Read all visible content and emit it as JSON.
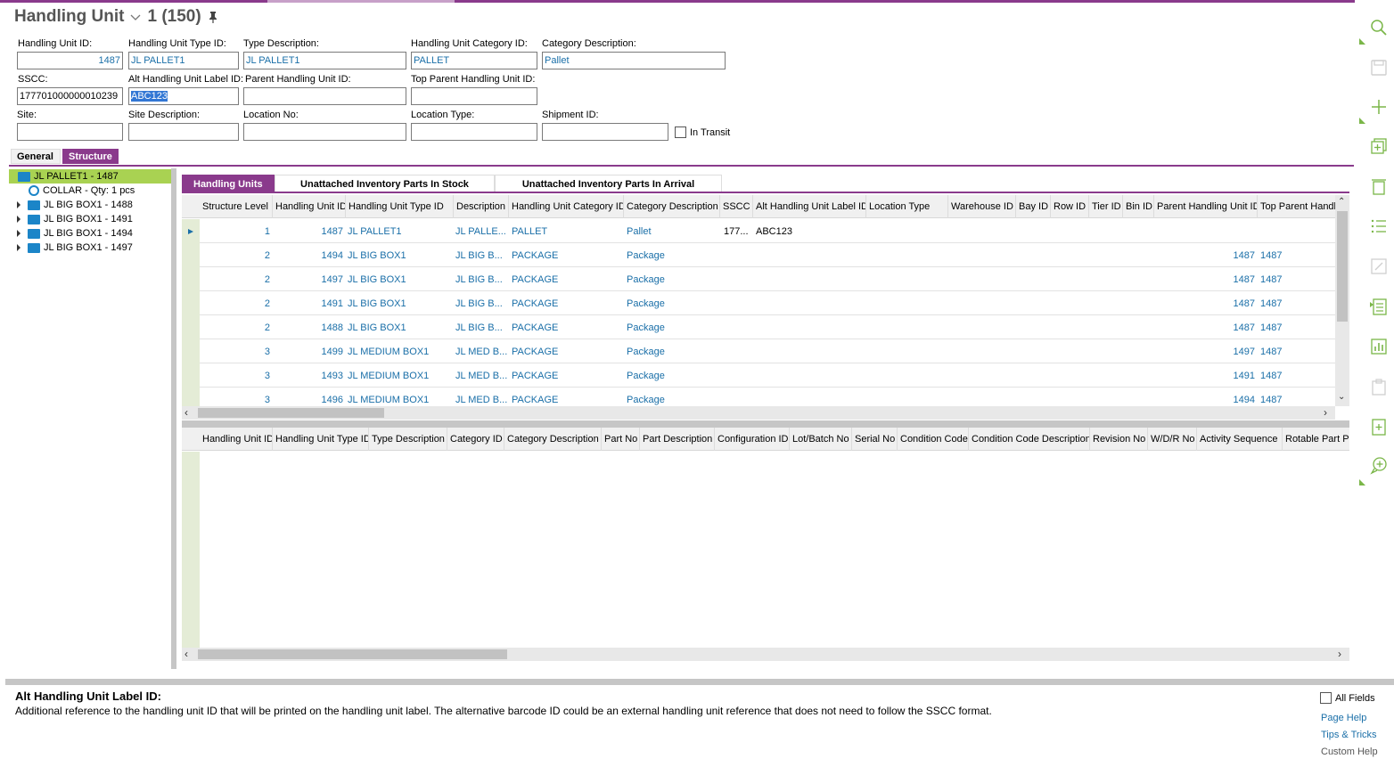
{
  "header": {
    "title": "Handling Unit",
    "record_count": "1 (150)"
  },
  "form": {
    "handling_unit_id": {
      "label": "Handling Unit ID:",
      "value": "1487"
    },
    "handling_unit_type_id": {
      "label": "Handling Unit Type ID:",
      "value": "JL PALLET1"
    },
    "type_description": {
      "label": "Type Description:",
      "value": "JL PALLET1"
    },
    "handling_unit_category_id": {
      "label": "Handling Unit Category ID:",
      "value": "PALLET"
    },
    "category_description": {
      "label": "Category Description:",
      "value": "Pallet"
    },
    "sscc": {
      "label": "SSCC:",
      "value": "177701000000010239"
    },
    "alt_handling_unit_label_id": {
      "label": "Alt Handling Unit Label ID:",
      "value": "ABC123"
    },
    "parent_handling_unit_id": {
      "label": "Parent Handling Unit ID:",
      "value": ""
    },
    "top_parent_handling_unit_id": {
      "label": "Top Parent Handling Unit ID:",
      "value": ""
    },
    "site": {
      "label": "Site:",
      "value": ""
    },
    "site_description": {
      "label": "Site Description:",
      "value": ""
    },
    "location_no": {
      "label": "Location No:",
      "value": ""
    },
    "location_type": {
      "label": "Location Type:",
      "value": ""
    },
    "shipment_id": {
      "label": "Shipment ID:",
      "value": ""
    },
    "in_transit": {
      "label": "In Transit",
      "checked": false
    }
  },
  "main_tabs": [
    "General",
    "Structure"
  ],
  "tree": [
    {
      "label": "JL PALLET1 - 1487",
      "type": "folder",
      "selected": true
    },
    {
      "label": "COLLAR - Qty: 1 pcs",
      "type": "part"
    },
    {
      "label": "JL BIG BOX1 - 1488",
      "type": "folder"
    },
    {
      "label": "JL BIG BOX1 - 1491",
      "type": "folder"
    },
    {
      "label": "JL BIG BOX1 - 1494",
      "type": "folder"
    },
    {
      "label": "JL BIG BOX1 - 1497",
      "type": "folder"
    }
  ],
  "sub_tabs": [
    "Handling Units",
    "Unattached Inventory Parts In Stock",
    "Unattached Inventory Parts In Arrival"
  ],
  "upper_grid": {
    "columns": [
      "Structure Level",
      "Handling Unit ID",
      "Handling Unit Type ID",
      "Description",
      "Handling Unit Category ID",
      "Category Description",
      "SSCC",
      "Alt Handling Unit Label ID",
      "Location Type",
      "Warehouse ID",
      "Bay ID",
      "Row ID",
      "Tier ID",
      "Bin ID",
      "Parent Handling Unit ID",
      "Top Parent Handli"
    ],
    "rows": [
      {
        "level": "1",
        "hu_id": "1487",
        "type_id": "JL PALLET1",
        "desc": "JL PALLE...",
        "cat_id": "PALLET",
        "cat_desc": "Pallet",
        "sscc": "177...",
        "alt": "ABC123",
        "parent": "",
        "top_parent": ""
      },
      {
        "level": "2",
        "hu_id": "1494",
        "type_id": "JL BIG BOX1",
        "desc": "JL BIG B...",
        "cat_id": "PACKAGE",
        "cat_desc": "Package",
        "sscc": "",
        "alt": "",
        "parent": "1487",
        "top_parent": "1487"
      },
      {
        "level": "2",
        "hu_id": "1497",
        "type_id": "JL BIG BOX1",
        "desc": "JL BIG B...",
        "cat_id": "PACKAGE",
        "cat_desc": "Package",
        "sscc": "",
        "alt": "",
        "parent": "1487",
        "top_parent": "1487"
      },
      {
        "level": "2",
        "hu_id": "1491",
        "type_id": "JL BIG BOX1",
        "desc": "JL BIG B...",
        "cat_id": "PACKAGE",
        "cat_desc": "Package",
        "sscc": "",
        "alt": "",
        "parent": "1487",
        "top_parent": "1487"
      },
      {
        "level": "2",
        "hu_id": "1488",
        "type_id": "JL BIG BOX1",
        "desc": "JL BIG B...",
        "cat_id": "PACKAGE",
        "cat_desc": "Package",
        "sscc": "",
        "alt": "",
        "parent": "1487",
        "top_parent": "1487"
      },
      {
        "level": "3",
        "hu_id": "1499",
        "type_id": "JL MEDIUM BOX1",
        "desc": "JL MED B...",
        "cat_id": "PACKAGE",
        "cat_desc": "Package",
        "sscc": "",
        "alt": "",
        "parent": "1497",
        "top_parent": "1487"
      },
      {
        "level": "3",
        "hu_id": "1493",
        "type_id": "JL MEDIUM BOX1",
        "desc": "JL MED B...",
        "cat_id": "PACKAGE",
        "cat_desc": "Package",
        "sscc": "",
        "alt": "",
        "parent": "1491",
        "top_parent": "1487"
      },
      {
        "level": "3",
        "hu_id": "1496",
        "type_id": "JL MEDIUM BOX1",
        "desc": "JL MED B...",
        "cat_id": "PACKAGE",
        "cat_desc": "Package",
        "sscc": "",
        "alt": "",
        "parent": "1494",
        "top_parent": "1487"
      }
    ]
  },
  "lower_grid": {
    "columns": [
      "Handling Unit ID",
      "Handling Unit Type ID",
      "Type Description",
      "Category ID",
      "Category Description",
      "Part No",
      "Part Description",
      "Configuration ID",
      "Lot/Batch No",
      "Serial No",
      "Condition Code",
      "Condition Code Description",
      "Revision No",
      "W/D/R No",
      "Activity Sequence",
      "Rotable Part Po"
    ]
  },
  "help": {
    "title": "Alt Handling Unit Label ID:",
    "text": "Additional reference to the handling unit ID that will be printed on the handling unit label. The alternative barcode ID could be an external handling unit reference that does not need to follow the SSCC format.",
    "all_fields": "All Fields",
    "page_help": "Page Help",
    "tips": "Tips & Tricks",
    "custom_help": "Custom Help"
  },
  "colors": {
    "accent": "#8a3a8c",
    "selection_green": "#a9d252",
    "link": "#1a6fa8",
    "icon_green": "#7ab648"
  }
}
